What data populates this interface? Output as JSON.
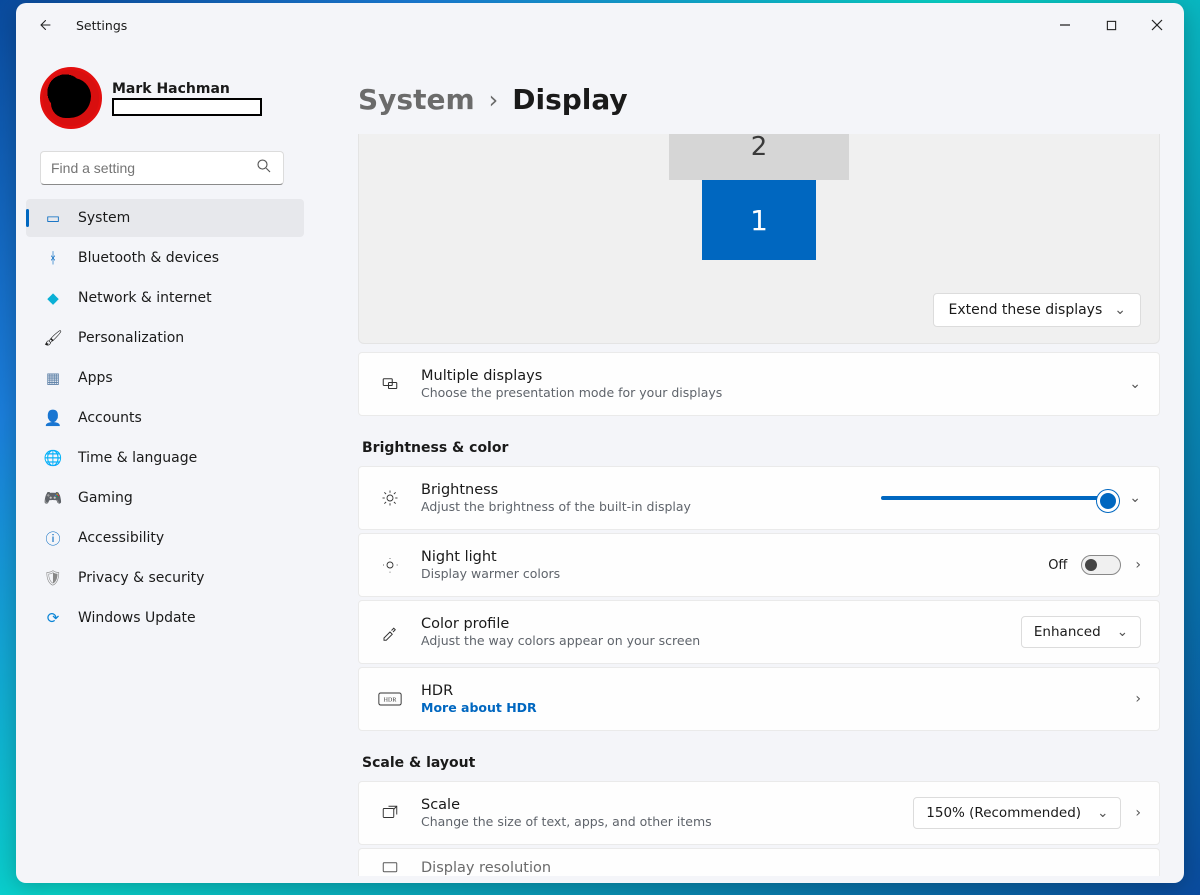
{
  "app_title": "Settings",
  "window_controls": {
    "minimize": "−",
    "maximize": "□",
    "close": "✕"
  },
  "profile": {
    "name": "Mark Hachman"
  },
  "search": {
    "placeholder": "Find a setting"
  },
  "sidebar": {
    "items": [
      {
        "label": "System",
        "icon": "monitor-icon",
        "active": true
      },
      {
        "label": "Bluetooth & devices",
        "icon": "bluetooth-icon"
      },
      {
        "label": "Network & internet",
        "icon": "wifi-icon"
      },
      {
        "label": "Personalization",
        "icon": "brush-icon"
      },
      {
        "label": "Apps",
        "icon": "apps-icon"
      },
      {
        "label": "Accounts",
        "icon": "person-icon"
      },
      {
        "label": "Time & language",
        "icon": "globe-icon"
      },
      {
        "label": "Gaming",
        "icon": "controller-icon"
      },
      {
        "label": "Accessibility",
        "icon": "accessibility-icon"
      },
      {
        "label": "Privacy & security",
        "icon": "shield-icon"
      },
      {
        "label": "Windows Update",
        "icon": "update-icon"
      }
    ]
  },
  "breadcrumb": {
    "parent": "System",
    "sep": "›",
    "current": "Display"
  },
  "monitors": {
    "primary": "1",
    "secondary": "2",
    "mode_label": "Extend these displays"
  },
  "multi": {
    "title": "Multiple displays",
    "sub": "Choose the presentation mode for your displays"
  },
  "sections": {
    "brightness_color": "Brightness & color",
    "scale_layout": "Scale & layout"
  },
  "brightness": {
    "title": "Brightness",
    "sub": "Adjust the brightness of the built-in display",
    "value_pct": 100
  },
  "night_light": {
    "title": "Night light",
    "sub": "Display warmer colors",
    "state_label": "Off",
    "state": false
  },
  "color_profile": {
    "title": "Color profile",
    "sub": "Adjust the way colors appear on your screen",
    "value": "Enhanced"
  },
  "hdr": {
    "title": "HDR",
    "link": "More about HDR"
  },
  "scale": {
    "title": "Scale",
    "sub": "Change the size of text, apps, and other items",
    "value": "150% (Recommended)"
  },
  "display_resolution": {
    "title": "Display resolution"
  }
}
